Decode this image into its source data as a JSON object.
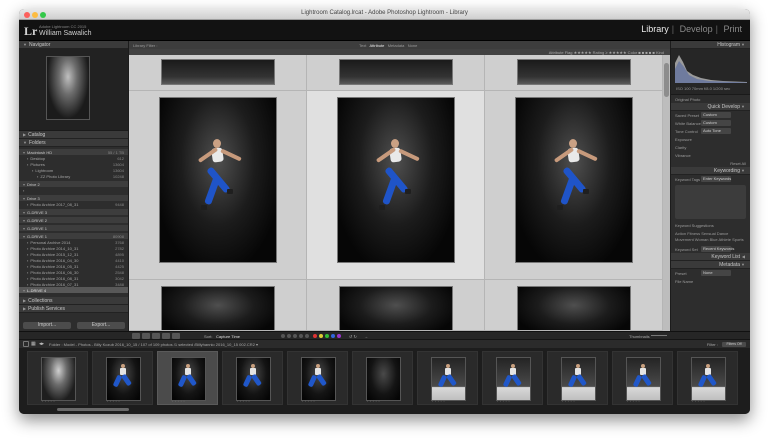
{
  "window": {
    "title": "Lightroom Catalog.lrcat - Adobe Photoshop Lightroom - Library"
  },
  "identity": {
    "logo": "Lr",
    "subtitle": "Adobe Lightroom CC 2015",
    "name": "William Sawalich",
    "modules": [
      "Library",
      "Develop",
      "Print"
    ],
    "active_module": "Library"
  },
  "left_panel": {
    "navigator": "Navigator",
    "navigator_zoom": "FIT  FILL  1:1  3:1",
    "catalog": "Catalog",
    "folders": "Folders",
    "collections": "Collections",
    "publish_services": "Publish Services",
    "import_label": "Import...",
    "export_label": "Export...",
    "folder_rows": [
      {
        "label": "Macintosh HD",
        "count": "55 / 1 TB",
        "kind": "vol",
        "indent": ""
      },
      {
        "label": "Desktop",
        "count": "612",
        "kind": "",
        "indent": "i1"
      },
      {
        "label": "Pictures",
        "count": "13604",
        "kind": "",
        "indent": "i1"
      },
      {
        "label": "Lightroom",
        "count": "13604",
        "kind": "",
        "indent": "i2"
      },
      {
        "label": "ZZ Photo Library",
        "count": "10248",
        "kind": "",
        "indent": "i3"
      },
      {
        "label": "Drive 2",
        "count": "",
        "kind": "vol",
        "indent": ""
      },
      {
        "label": "",
        "count": "",
        "kind": "",
        "indent": ""
      },
      {
        "label": "Drive 3",
        "count": "",
        "kind": "vol",
        "indent": ""
      },
      {
        "label": "Photo Archive 2017_08_31",
        "count": "9448",
        "kind": "",
        "indent": "i1"
      },
      {
        "label": "G-DRIVE 3",
        "count": "",
        "kind": "vol",
        "indent": ""
      },
      {
        "label": "G-DRIVE 2",
        "count": "",
        "kind": "vol",
        "indent": ""
      },
      {
        "label": "G-DRIVE 1",
        "count": "",
        "kind": "vol",
        "indent": ""
      },
      {
        "label": "G-DRIVE 1",
        "count": "80908",
        "kind": "vol",
        "indent": ""
      },
      {
        "label": "Personal Archive 2014",
        "count": "3768",
        "kind": "",
        "indent": "i1"
      },
      {
        "label": "Photo Archive 2014_10_31",
        "count": "2782",
        "kind": "",
        "indent": "i1"
      },
      {
        "label": "Photo Archive 2015_12_31",
        "count": "4895",
        "kind": "",
        "indent": "i1"
      },
      {
        "label": "Photo Archive 2016_04_30",
        "count": "4410",
        "kind": "",
        "indent": "i1"
      },
      {
        "label": "Photo Archive 2016_05_31",
        "count": "4425",
        "kind": "",
        "indent": "i1"
      },
      {
        "label": "Photo Archive 2016_06_30",
        "count": "2548",
        "kind": "",
        "indent": "i1"
      },
      {
        "label": "Photo Archive 2016_08_31",
        "count": "3042",
        "kind": "",
        "indent": "i1"
      },
      {
        "label": "Photo Archive 2016_07_31",
        "count": "3488",
        "kind": "",
        "indent": "i1"
      },
      {
        "label": "L-DRIVE 4",
        "count": "",
        "kind": "sel",
        "indent": ""
      }
    ]
  },
  "main": {
    "library_filter": "Library Filter :",
    "filter_tabs": [
      "Text",
      "Attribute",
      "Metadata",
      "None"
    ],
    "active_filter_tab": "Attribute",
    "attr_tools": "Attribute  Flag  ★★★★★  Rating  ≥  ★★★★★  Color  ■ ■ ■ ■ ■  Kind",
    "cells": [
      {
        "idx": "",
        "type": "landscape-top"
      },
      {
        "idx": "",
        "type": "landscape-top"
      },
      {
        "idx": "",
        "type": "landscape-top"
      },
      {
        "idx": "",
        "type": "athlete"
      },
      {
        "idx": "",
        "type": "athlete"
      },
      {
        "idx": "",
        "type": "athlete"
      },
      {
        "idx": "",
        "type": "landscape-bottom"
      },
      {
        "idx": "",
        "type": "landscape-bottom"
      },
      {
        "idx": "",
        "type": "landscape-bottom"
      }
    ]
  },
  "toolbar": {
    "sort_label": "Sort:",
    "sort_value": "Capture Time",
    "thumbnails_label": "Thumbnails"
  },
  "filmstrip": {
    "breadcrumb": "Folder : Model - Photos - Billy Kozub 2016_10_15  /  107 of 109 photos /1 selected /Billyhannio 2016_10_15 002.CR2 ▾",
    "filter_label": "Filter :",
    "filter_value": "Filters Off",
    "thumbs": [
      "bright",
      "athlete",
      "athlete",
      "athlete",
      "athlete",
      "dark",
      "studio",
      "studio",
      "studio",
      "studio",
      "studio"
    ]
  },
  "right_panel": {
    "histogram": "Histogram",
    "histogram_info": "ISO 100   70mm   f/8.0   1/200 sec",
    "original_photo": "Original Photo",
    "quick_develop": "Quick Develop",
    "saved_preset_label": "Saved Preset",
    "saved_preset_value": "Custom",
    "white_balance_label": "White Balance",
    "white_balance_value": "Custom",
    "tone_control_label": "Tone Control",
    "tone_control_value": "Auto Tone",
    "exposure_label": "Exposure",
    "clarity_label": "Clarity",
    "vibrance_label": "Vibrance",
    "reset_label": "Reset All",
    "keywording": "Keywording",
    "keyword_tags_label": "Keyword Tags",
    "keyword_tags_value": "Enter Keywords",
    "keyword_suggestions": "Keyword Suggestions",
    "suggestion_words": "Action  Fitness  Sensual  Dance  Movement  Woman  Blue  Athlete  Sports",
    "keyword_set_label": "Keyword Set",
    "keyword_set_value": "Recent Keywords",
    "keyword_list": "Keyword List",
    "metadata": "Metadata",
    "metadata_preset": "Default",
    "meta_preset_label": "Preset",
    "meta_preset_value": "None",
    "meta_file_label": "File Name",
    "meta_file_value": "Billyhannio_2016_10_15 002.CR2"
  },
  "colors": {
    "window_bg": "#3a3a3a",
    "panel_bg": "#2d2d2d",
    "grid_bg": "#c6c6c6",
    "film_bg": "#1d1d1d",
    "blue_tights": "#1f54c8"
  }
}
